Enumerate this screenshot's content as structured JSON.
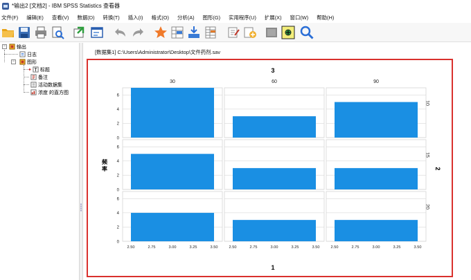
{
  "window": {
    "title": "*输出2 [文档2] - IBM SPSS Statistics 查看器"
  },
  "menu": [
    "文件(F)",
    "编辑(E)",
    "查看(V)",
    "数据(D)",
    "转换(T)",
    "插入(I)",
    "格式(O)",
    "分析(A)",
    "图形(G)",
    "实用程序(U)",
    "扩展(X)",
    "窗口(W)",
    "帮助(H)"
  ],
  "toolbar_icons": [
    "open-folder-icon",
    "save-icon",
    "print-icon",
    "print-preview-icon",
    "export-icon",
    "recall-dialog-icon",
    "undo-icon",
    "redo-icon",
    "goto-data-icon",
    "goto-case-icon",
    "goto-variable-icon",
    "variables-icon",
    "insert-heading-icon",
    "insert-title-icon",
    "insert-text-icon",
    "show-hide-icon",
    "promote-icon",
    "search-icon"
  ],
  "outline": {
    "root": "输出",
    "log": "日志",
    "graph": "图形",
    "children": [
      "标题",
      "备注",
      "活动数据集",
      "浓度 的直方图"
    ]
  },
  "dataset_label": "[数据集1] C:\\Users\\Administrator\\Desktop\\文件药剂.sav",
  "chart_data": {
    "type": "bar",
    "col_panel_title": "3",
    "col_panels": [
      "30",
      "60",
      "90"
    ],
    "row_panel_title": "2",
    "row_panels": [
      "10",
      "15",
      "20"
    ],
    "ylabel": "频率",
    "xlabel": "1",
    "ylim": [
      0,
      7
    ],
    "yticks": [
      0,
      2,
      4,
      6
    ],
    "xlim": [
      2.4,
      3.6
    ],
    "xticks": [
      "2.50",
      "2.75",
      "3.00",
      "3.25",
      "3.50"
    ],
    "bar_range": [
      2.5,
      3.5
    ],
    "bar_color": "#1a8fe3",
    "frequencies": [
      [
        7,
        3,
        5
      ],
      [
        5,
        3,
        3
      ],
      [
        4,
        3,
        3
      ]
    ]
  }
}
